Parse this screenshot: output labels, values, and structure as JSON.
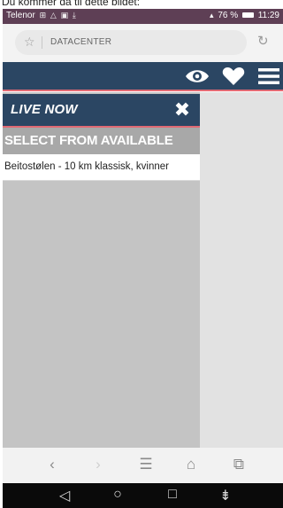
{
  "caption": "Du kommer da til dette bildet:",
  "statusbar": {
    "carrier": "Telenor",
    "battery": "76 %",
    "time": "11:29",
    "background": "#5e3f55"
  },
  "browser": {
    "url": "DATACENTER",
    "star_icon": "star-icon",
    "reload_icon": "reload-icon"
  },
  "site": {
    "accent": "#2b4663",
    "underline": "#e06a74",
    "icons": [
      "eye-icon",
      "heart-icon",
      "menu-icon"
    ]
  },
  "panel": {
    "title": "LIVE NOW",
    "close_label": "✖",
    "select_header": "SELECT FROM AVAILABLE",
    "items": [
      {
        "label": "Beitostølen - 10 km klassisk, kvinner"
      }
    ]
  },
  "browser_nav": {
    "back": "‹",
    "forward": "›",
    "menu": "☰",
    "home": "⌂",
    "tabs": "⧉"
  },
  "android_nav": {
    "back": "◁",
    "home": "○",
    "recents": "□",
    "notifications": "⇟"
  }
}
